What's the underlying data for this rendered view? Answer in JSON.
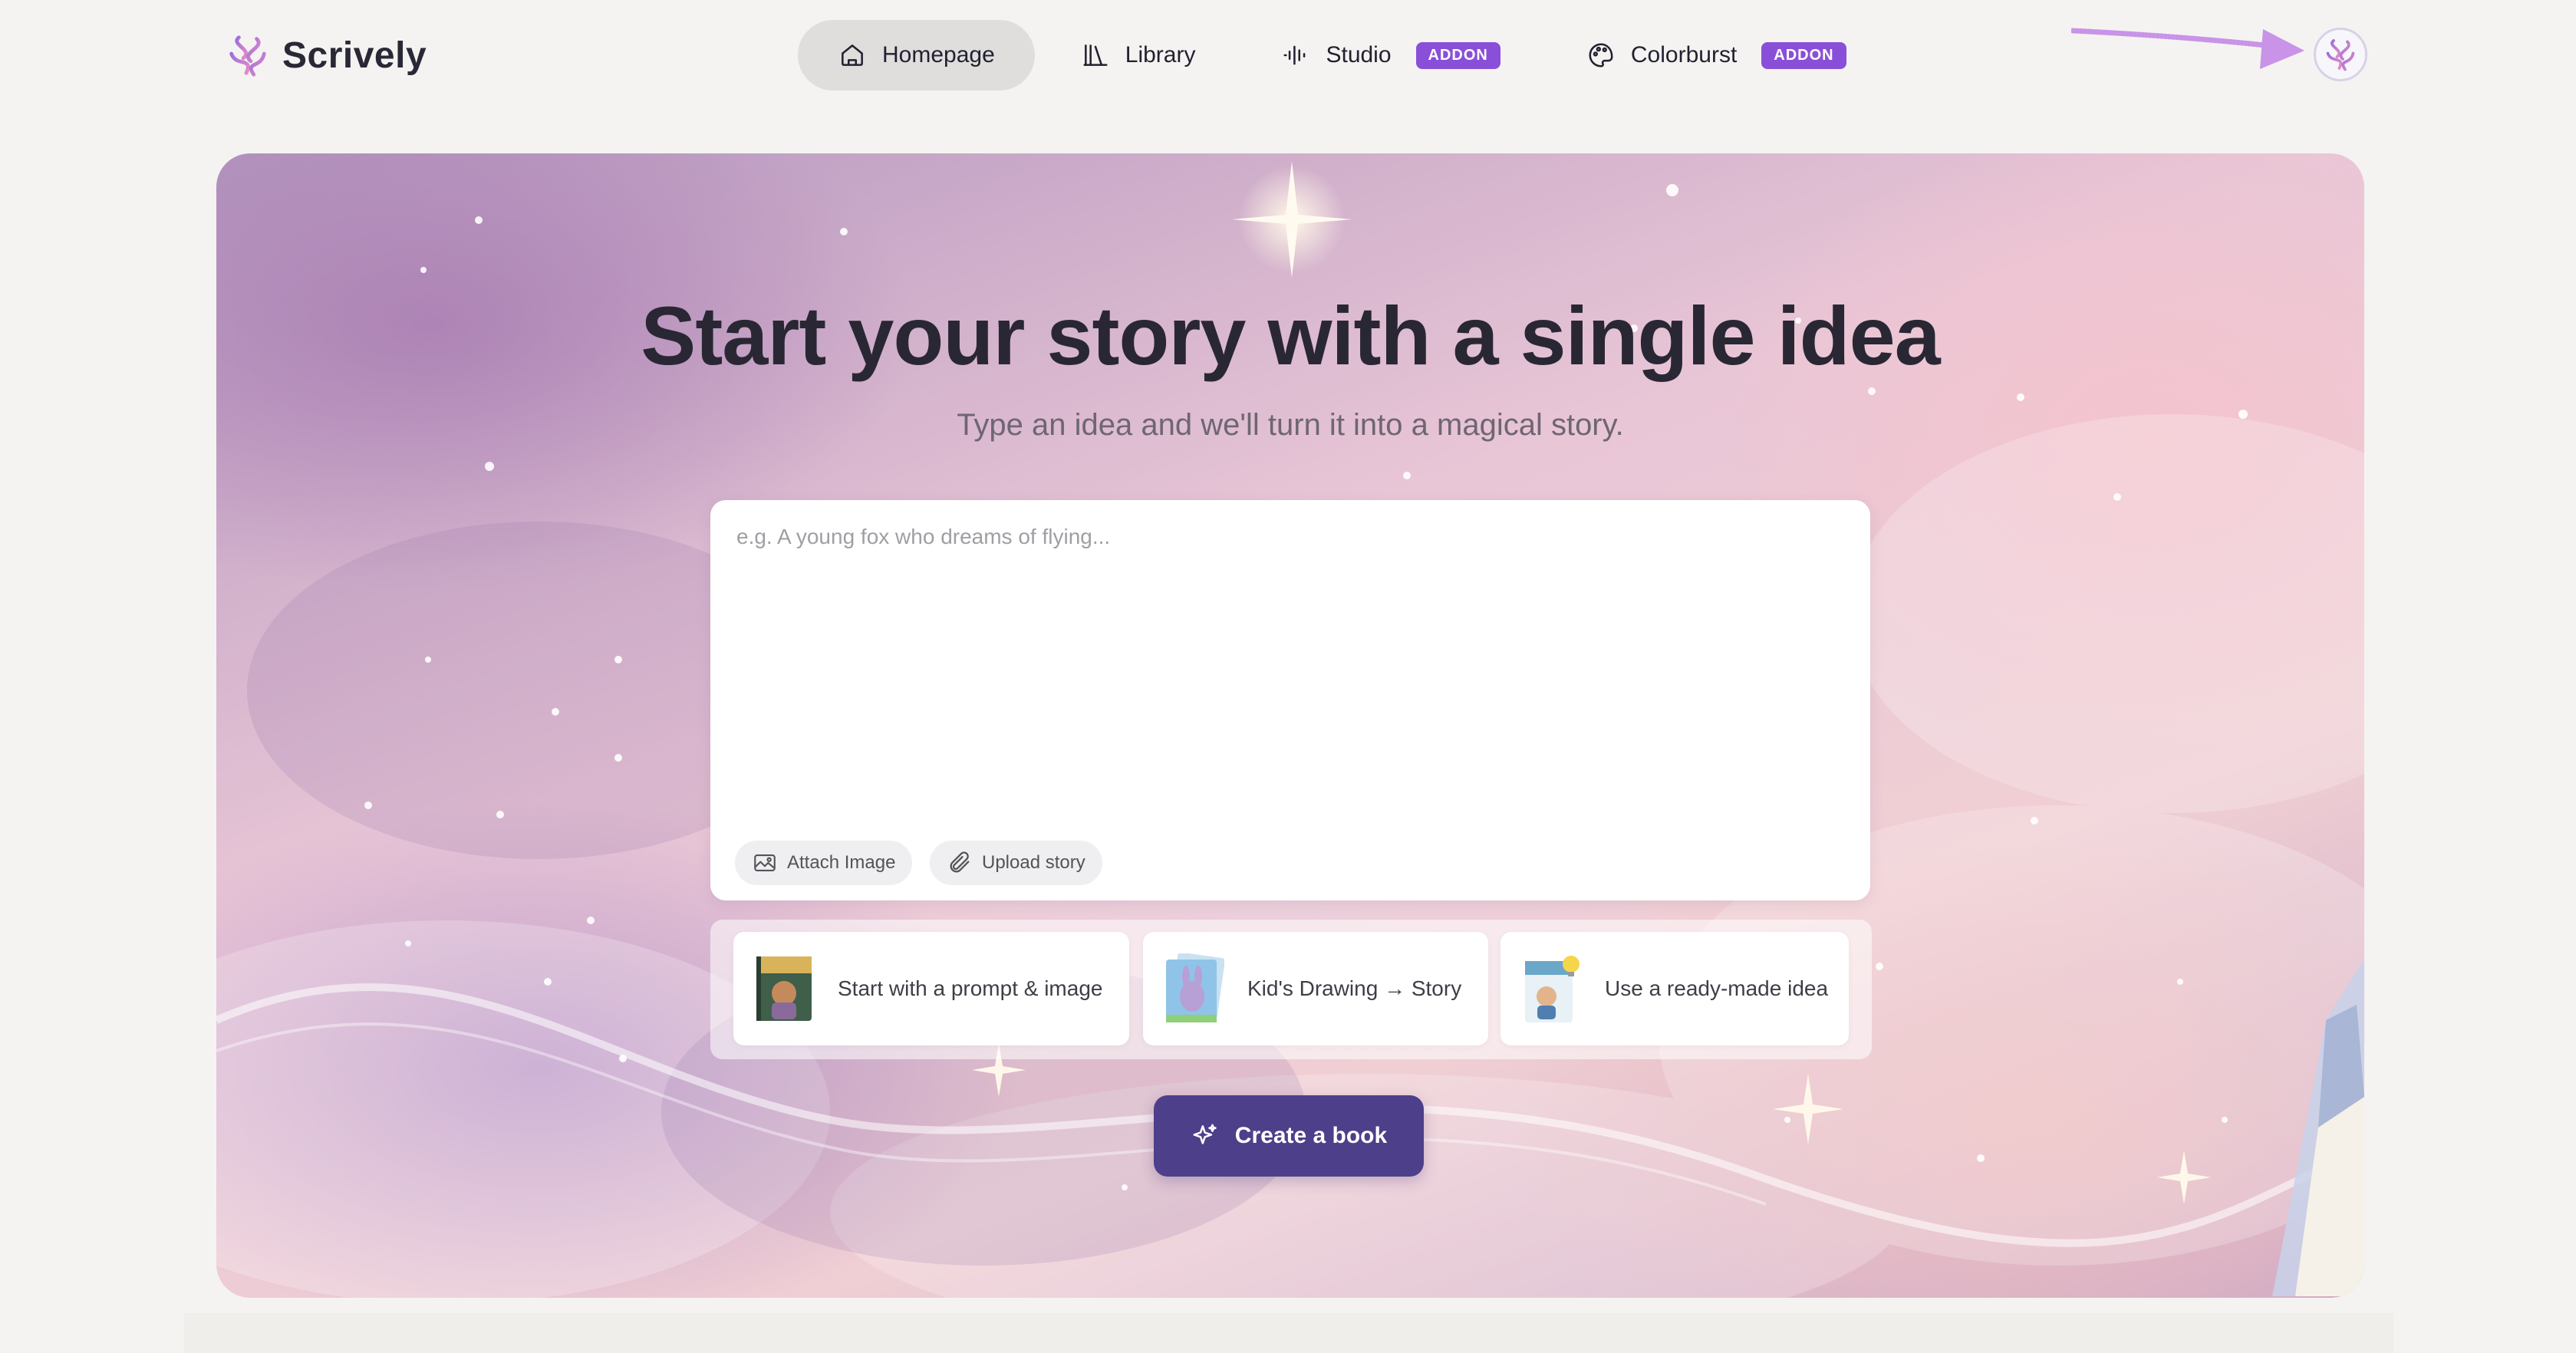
{
  "app": {
    "name": "Scrively"
  },
  "nav": {
    "items": [
      {
        "label": "Homepage",
        "icon": "home-icon",
        "active": true
      },
      {
        "label": "Library",
        "icon": "library-icon",
        "active": false
      },
      {
        "label": "Studio",
        "icon": "audio-wave-icon",
        "badge": "ADDON",
        "active": false
      },
      {
        "label": "Colorburst",
        "icon": "palette-icon",
        "badge": "ADDON",
        "active": false
      }
    ]
  },
  "hero": {
    "title": "Start your story with a single idea",
    "subtitle": "Type an idea and we'll turn it into a magical story.",
    "prompt": {
      "placeholder": "e.g. A young fox who dreams of flying...",
      "value": ""
    },
    "chips": {
      "attach_label": "Attach Image",
      "upload_label": "Upload story"
    },
    "options": [
      {
        "label": "Start with a prompt & image"
      },
      {
        "label": "Kid's Drawing → Story"
      },
      {
        "label": "Use a ready-made idea"
      }
    ],
    "create_label": "Create a book"
  },
  "colors": {
    "accent": "#8a4fd8",
    "primary_button": "#4d3f8a",
    "active_nav": "#dfdedd",
    "page_bg": "#f4f3f1"
  }
}
